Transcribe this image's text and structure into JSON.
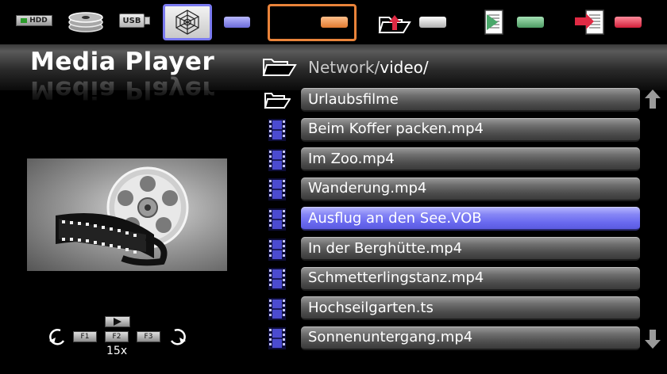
{
  "toolbar": {
    "hdd_label": "HDD",
    "usb_label": "USB",
    "items": [
      {
        "icon": "hdd-icon"
      },
      {
        "icon": "disc-stack-icon"
      },
      {
        "icon": "usb-icon"
      },
      {
        "icon": "network-icon",
        "selected": true
      },
      {
        "icon": "blue-key",
        "color": "#7a7af0"
      },
      {
        "icon": "orange-key",
        "color": "#e9833a"
      },
      {
        "icon": "folder-up-icon"
      },
      {
        "icon": "white-key",
        "color": "#d8d8d8"
      },
      {
        "icon": "document-play-icon"
      },
      {
        "icon": "green-key",
        "color": "#5aa870"
      },
      {
        "icon": "document-exit-icon"
      },
      {
        "icon": "red-key",
        "color": "#e02a44"
      }
    ]
  },
  "header": {
    "title": "Media Player",
    "path_root": "Network/",
    "path_current": "video/"
  },
  "controls": {
    "f1": "F1",
    "f2": "F2",
    "f3": "F3",
    "speed": "15x"
  },
  "files": [
    {
      "name": "Urlaubsfilme",
      "type": "folder"
    },
    {
      "name": "Beim Koffer packen.mp4",
      "type": "video"
    },
    {
      "name": "Im Zoo.mp4",
      "type": "video"
    },
    {
      "name": "Wanderung.mp4",
      "type": "video"
    },
    {
      "name": "Ausflug an den See.VOB",
      "type": "video",
      "selected": true
    },
    {
      "name": "In der Berghütte.mp4",
      "type": "video"
    },
    {
      "name": "Schmetterlingstanz.mp4",
      "type": "video"
    },
    {
      "name": "Hochseilgarten.ts",
      "type": "video"
    },
    {
      "name": "Sonnenuntergang.mp4",
      "type": "video"
    }
  ],
  "colors": {
    "selected_row": "#7575f2",
    "selected_source_border": "#7a7af0",
    "orange_frame": "#e9833a"
  }
}
